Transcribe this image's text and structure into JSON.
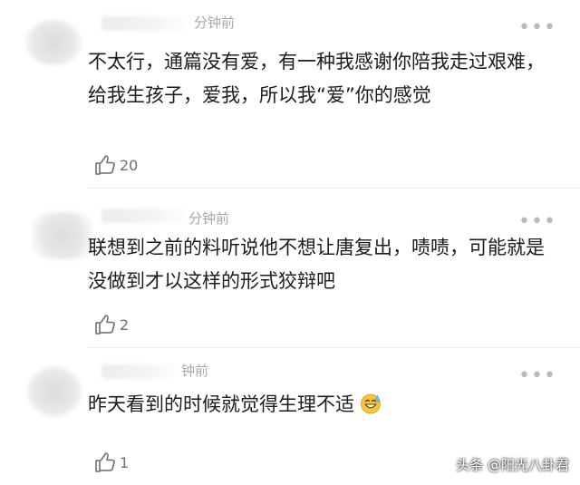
{
  "comments": [
    {
      "time": "分钟前",
      "content": "不太行，通篇没有爱，有一种我感谢你陪我走过艰难，给我生孩子，爱我，所以我“爱”你的感觉",
      "likes": "20"
    },
    {
      "time": "分钟前",
      "content": "联想到之前的料听说他不想让唐复出，啧啧，可能就是没做到才以这样的形式狡辩吧",
      "likes": "2"
    },
    {
      "time": "钟前",
      "content": "昨天看到的时候就觉得生理不适",
      "likes": "1",
      "emoji": "sweat-smile-emoji"
    }
  ],
  "more_glyph": "•••",
  "icons": {
    "like": "thumbs-up-icon",
    "more": "more-dots-icon",
    "emoji": "sweat-smile-emoji"
  },
  "watermark": "头条 @阳光八卦君"
}
